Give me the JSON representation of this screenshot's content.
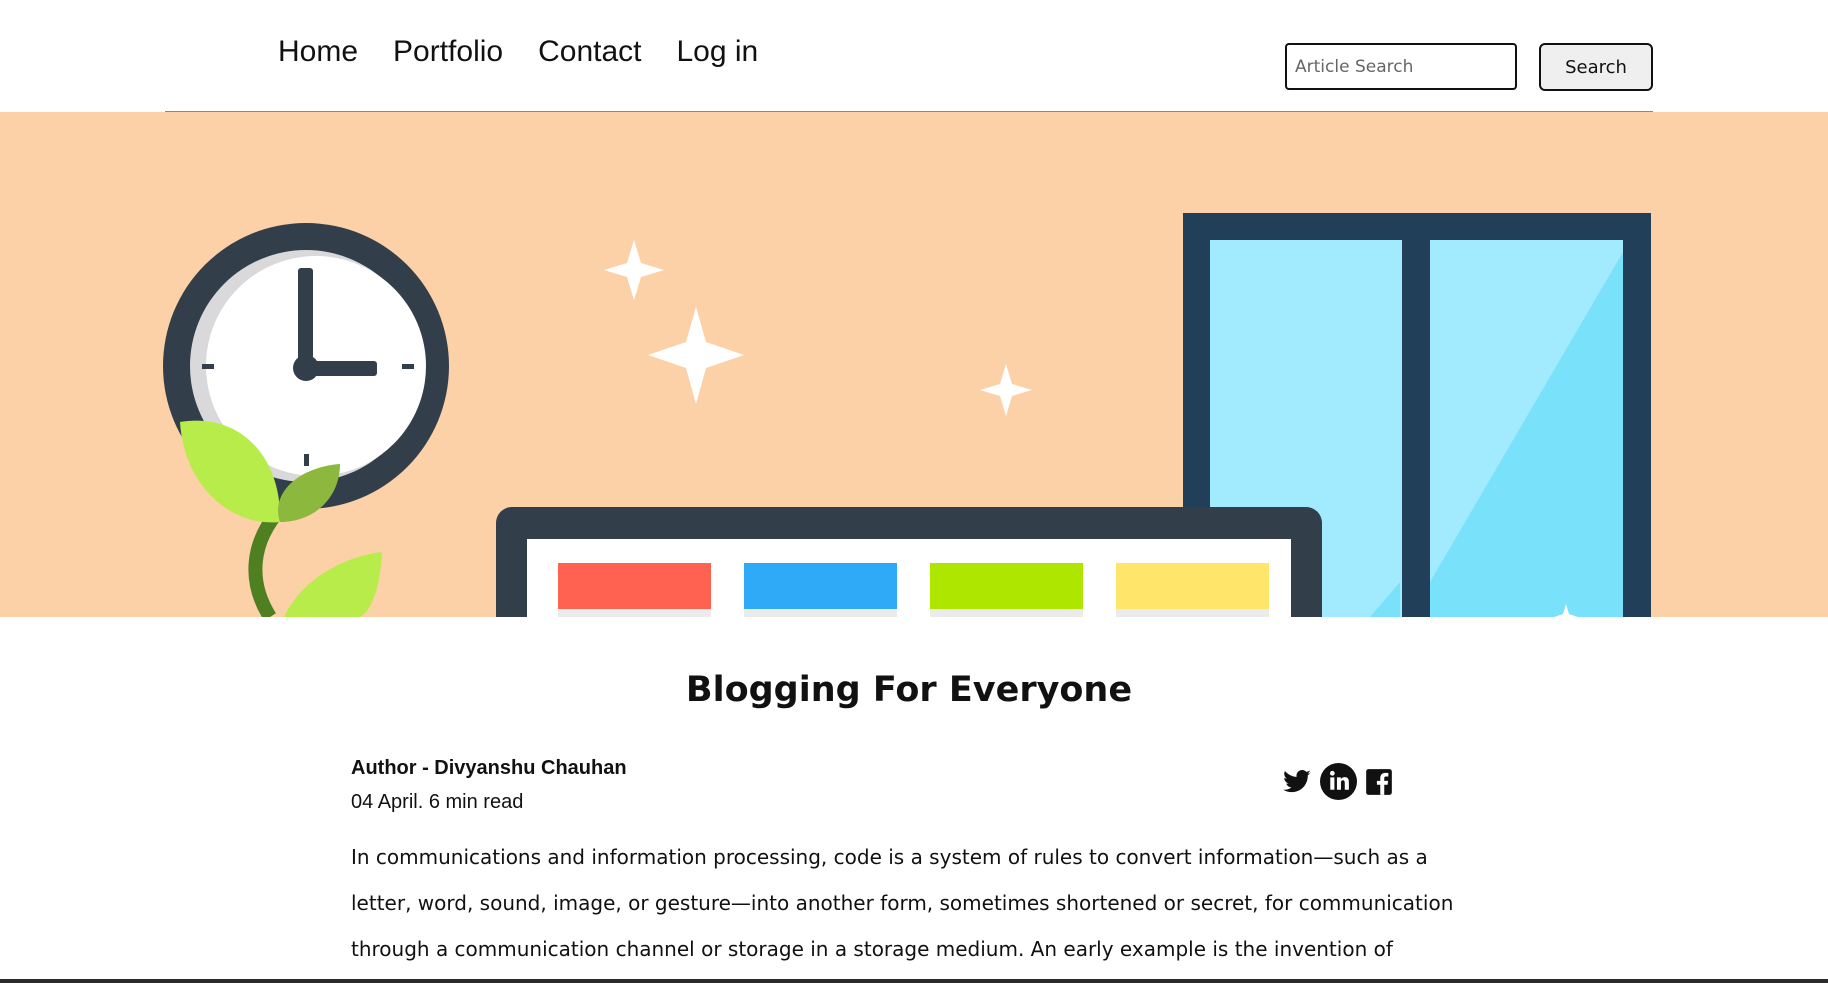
{
  "nav": {
    "links": [
      {
        "label": "Home"
      },
      {
        "label": "Portfolio"
      },
      {
        "label": "Contact"
      },
      {
        "label": "Log in"
      }
    ],
    "search_placeholder": "Article Search",
    "search_button": "Search"
  },
  "hero": {
    "background_color": "#fdd1a8",
    "illustration_icons": [
      "clock-icon",
      "sparkle-icon",
      "plant-icon",
      "laptop-icon",
      "window-icon"
    ],
    "swatch_colors": [
      "#ff6251",
      "#2eaaf7",
      "#aee600",
      "#ffe66a"
    ]
  },
  "article": {
    "title": "Blogging For Everyone",
    "author": "Author - Divyanshu Chauhan",
    "meta": "04 April. 6 min read",
    "social_icons": [
      "twitter-icon",
      "linkedin-icon",
      "facebook-icon"
    ],
    "body": "In communications and information processing, code is a system of rules to convert information—such as a letter, word, sound, image, or gesture—into another form, sometimes shortened or secret, for communication through a communication channel or storage in a storage medium. An early example is the invention of language, which"
  }
}
